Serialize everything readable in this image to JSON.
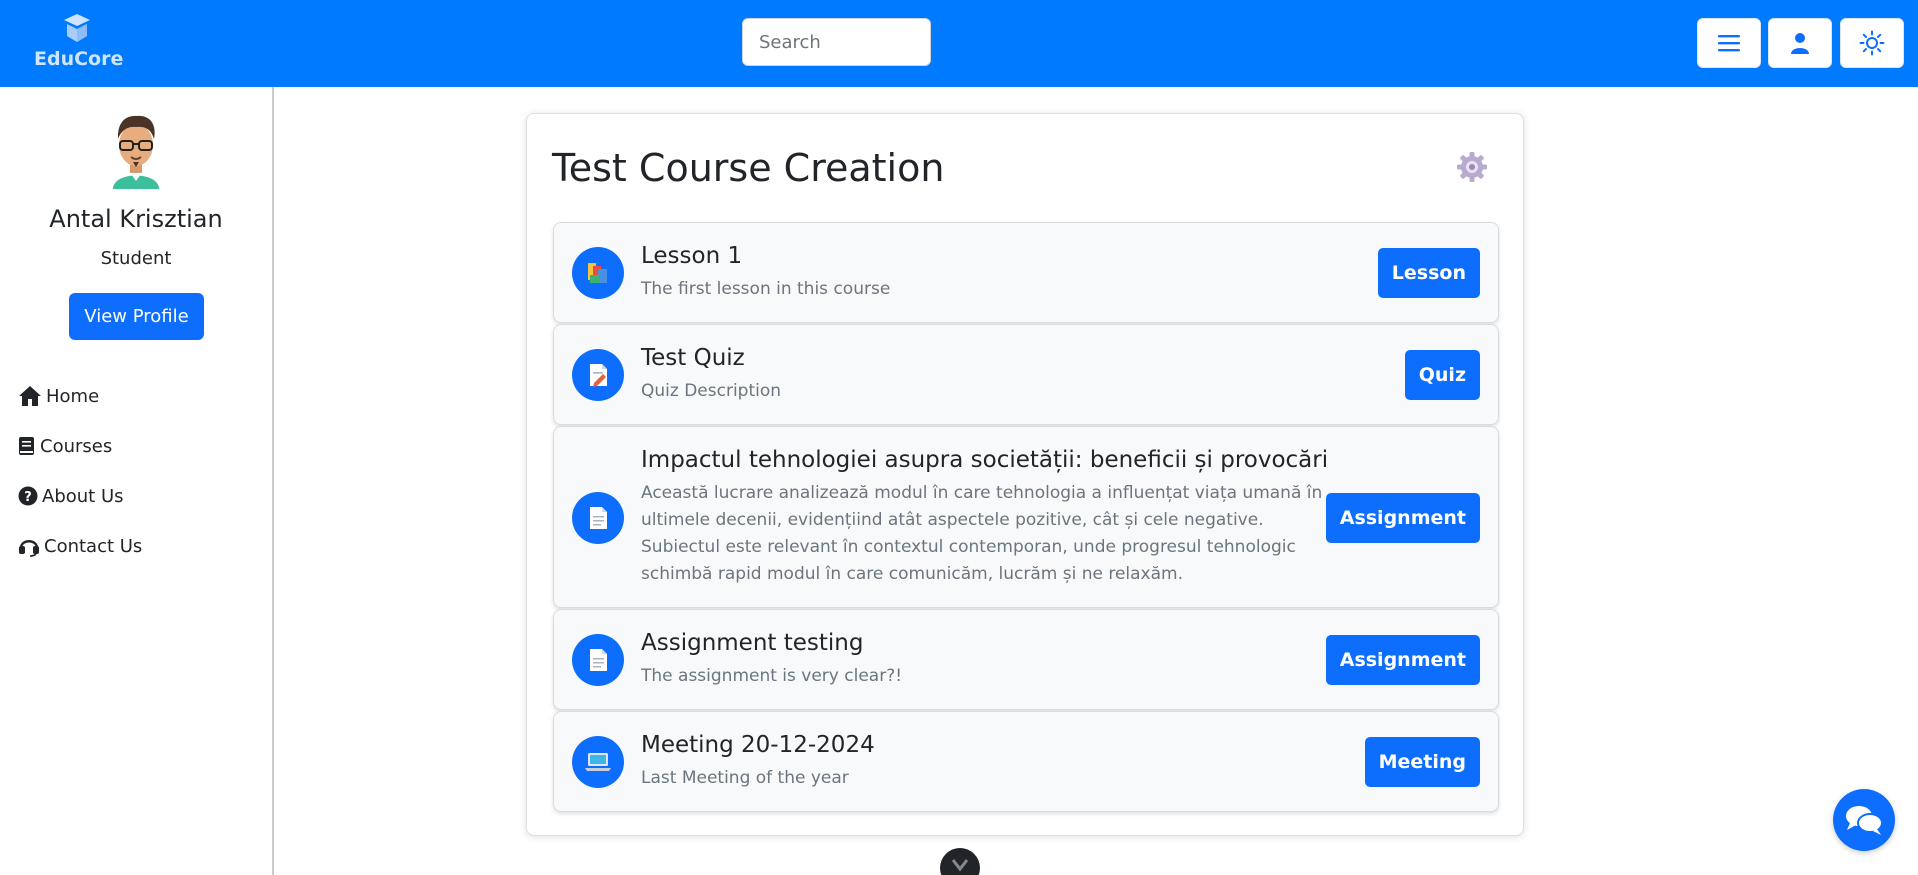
{
  "brand": {
    "name": "EduCore"
  },
  "search": {
    "placeholder": "Search"
  },
  "topbar": {
    "menu_icon": "hamburger-icon",
    "user_icon": "user-icon",
    "theme_icon": "sun-icon"
  },
  "profile": {
    "name": "Antal Krisztian",
    "role": "Student",
    "button": "View Profile"
  },
  "nav": [
    {
      "label": "Home",
      "icon": "home-icon"
    },
    {
      "label": "Courses",
      "icon": "book-icon"
    },
    {
      "label": "About Us",
      "icon": "question-icon"
    },
    {
      "label": "Contact Us",
      "icon": "headset-icon"
    }
  ],
  "course": {
    "title": "Test Course Creation",
    "items": [
      {
        "title": "Lesson 1",
        "description": "The first lesson in this course",
        "type": "Lesson",
        "icon": "books-icon"
      },
      {
        "title": "Test Quiz",
        "description": "Quiz Description",
        "type": "Quiz",
        "icon": "quiz-icon"
      },
      {
        "title": "Impactul tehnologiei asupra societății: beneficii și provocări",
        "description": "Această lucrare analizează modul în care tehnologia a influențat viața umană în ultimele decenii, evidențiind atât aspectele pozitive, cât și cele negative. Subiectul este relevant în contextul contemporan, unde progresul tehnologic schimbă rapid modul în care comunicăm, lucrăm și ne relaxăm.",
        "type": "Assignment",
        "icon": "document-icon"
      },
      {
        "title": "Assignment testing",
        "description": "The assignment is very clear?!",
        "type": "Assignment",
        "icon": "document-icon"
      },
      {
        "title": "Meeting 20-12-2024",
        "description": "Last Meeting of the year",
        "type": "Meeting",
        "icon": "laptop-icon"
      }
    ]
  },
  "colors": {
    "primary": "#007bff",
    "button": "#0d6efd",
    "card_bg": "#f8f9fa"
  }
}
